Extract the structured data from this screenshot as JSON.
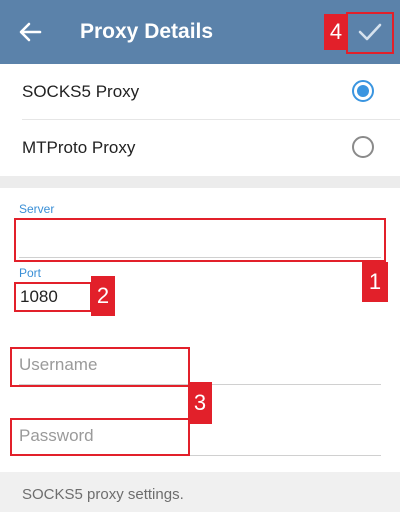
{
  "appbar": {
    "title": "Proxy Details",
    "back_icon": "arrow-left-icon",
    "done_icon": "checkmark-icon",
    "background": "#5b82aa"
  },
  "proxy_types": [
    {
      "label": "SOCKS5 Proxy",
      "selected": true
    },
    {
      "label": "MTProto Proxy",
      "selected": false
    }
  ],
  "fields": {
    "server": {
      "label": "Server",
      "value": "",
      "placeholder": ""
    },
    "port": {
      "label": "Port",
      "value": "1080"
    },
    "username": {
      "placeholder": "Username",
      "value": ""
    },
    "password": {
      "placeholder": "Password",
      "value": ""
    }
  },
  "annotations": {
    "badge_1": "1",
    "badge_2": "2",
    "badge_3": "3",
    "badge_4": "4",
    "color": "#e2202a"
  },
  "footer": {
    "text": "SOCKS5 proxy settings."
  },
  "accent_color": "#3a95e0"
}
